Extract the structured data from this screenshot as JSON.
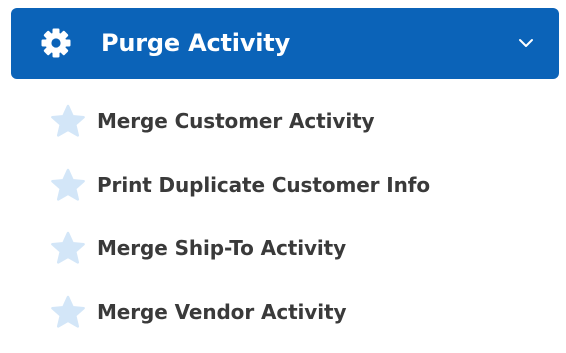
{
  "menu": {
    "header": {
      "label": "Purge Activity",
      "icon": "gear-icon",
      "expand_icon": "chevron-down-icon",
      "expanded": true
    },
    "items": [
      {
        "label": "Merge Customer Activity",
        "icon": "star-icon"
      },
      {
        "label": "Print Duplicate Customer Info",
        "icon": "star-icon"
      },
      {
        "label": "Merge Ship-To Activity",
        "icon": "star-icon"
      },
      {
        "label": "Merge Vendor Activity",
        "icon": "star-icon"
      }
    ]
  },
  "colors": {
    "header_background": "#0b63b8",
    "header_text": "#ffffff",
    "item_text": "#3a3a3a",
    "star_fill": "#d3e6f8"
  }
}
